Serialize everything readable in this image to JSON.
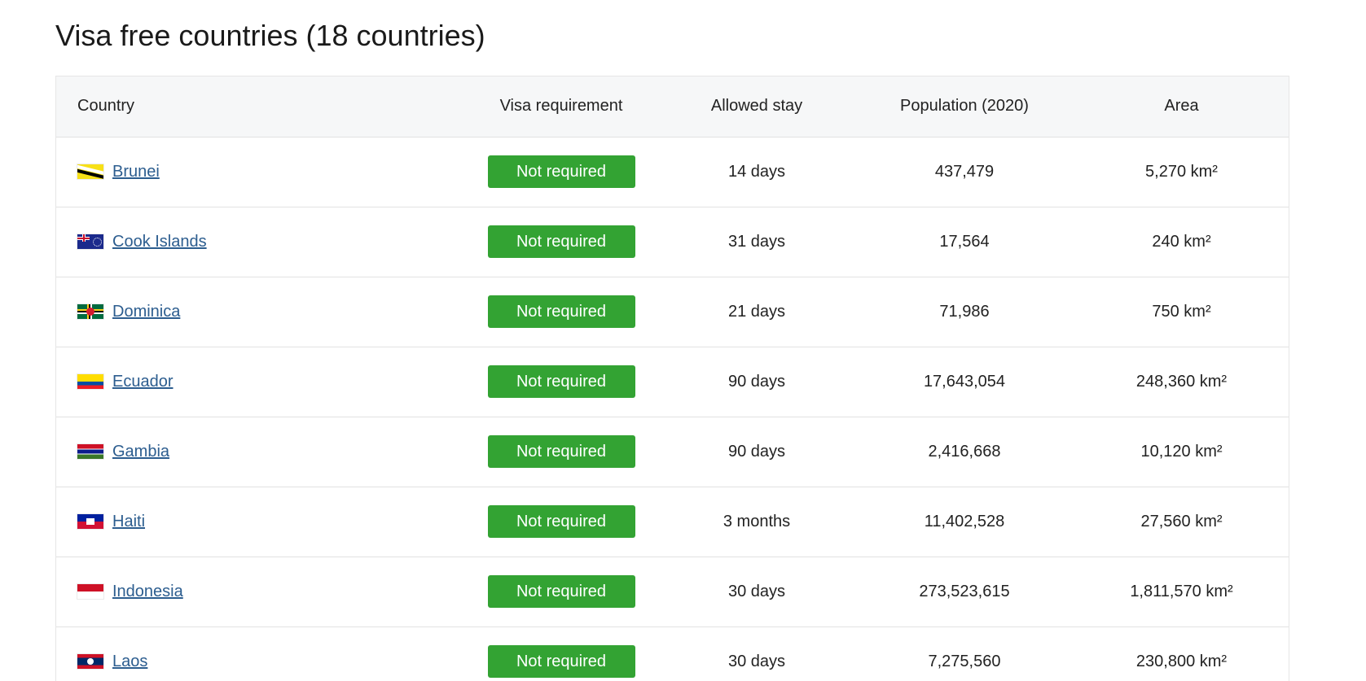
{
  "page": {
    "title": "Visa free countries (18 countries)"
  },
  "table": {
    "headers": {
      "country": "Country",
      "visa": "Visa requirement",
      "stay": "Allowed stay",
      "population": "Population (2020)",
      "area": "Area"
    },
    "rows": [
      {
        "country": "Brunei",
        "flag": "brunei-flag-icon",
        "visa": "Not required",
        "stay": "14 days",
        "population": "437,479",
        "area": "5,270 km²"
      },
      {
        "country": "Cook Islands",
        "flag": "cook-islands-flag-icon",
        "visa": "Not required",
        "stay": "31 days",
        "population": "17,564",
        "area": "240 km²"
      },
      {
        "country": "Dominica",
        "flag": "dominica-flag-icon",
        "visa": "Not required",
        "stay": "21 days",
        "population": "71,986",
        "area": "750 km²"
      },
      {
        "country": "Ecuador",
        "flag": "ecuador-flag-icon",
        "visa": "Not required",
        "stay": "90 days",
        "population": "17,643,054",
        "area": "248,360 km²"
      },
      {
        "country": "Gambia",
        "flag": "gambia-flag-icon",
        "visa": "Not required",
        "stay": "90 days",
        "population": "2,416,668",
        "area": "10,120 km²"
      },
      {
        "country": "Haiti",
        "flag": "haiti-flag-icon",
        "visa": "Not required",
        "stay": "3 months",
        "population": "11,402,528",
        "area": "27,560 km²"
      },
      {
        "country": "Indonesia",
        "flag": "indonesia-flag-icon",
        "visa": "Not required",
        "stay": "30 days",
        "population": "273,523,615",
        "area": "1,811,570 km²"
      },
      {
        "country": "Laos",
        "flag": "laos-flag-icon",
        "visa": "Not required",
        "stay": "30 days",
        "population": "7,275,560",
        "area": "230,800 km²"
      }
    ]
  },
  "colors": {
    "badge_green": "#33a333",
    "link_blue": "#2c5d8f",
    "header_bg": "#f6f7f8"
  }
}
